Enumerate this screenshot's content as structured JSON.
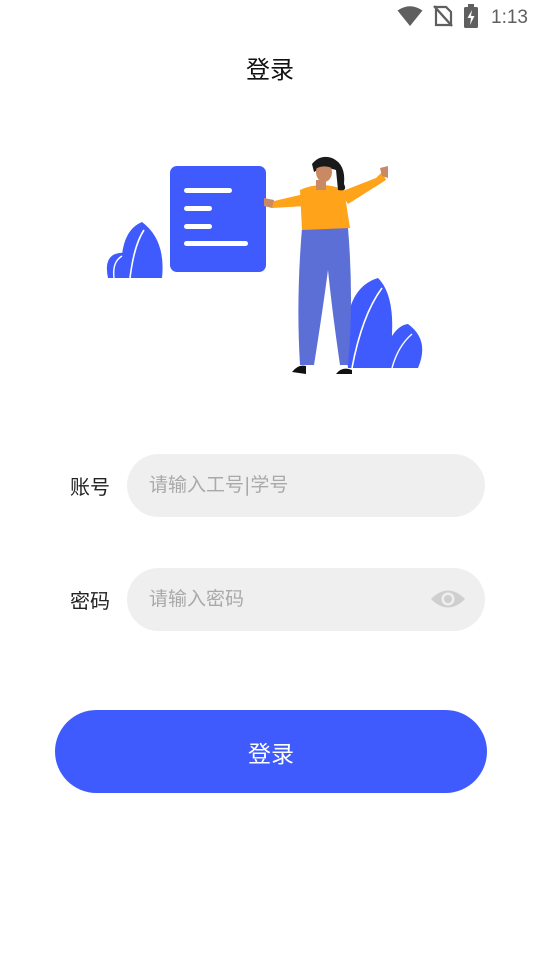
{
  "status_bar": {
    "time": "1:13",
    "icons": [
      "wifi-icon",
      "no-sim-icon",
      "battery-charging-icon"
    ]
  },
  "header": {
    "title": "登录"
  },
  "illustration": {
    "description_icon": "person-with-document-illustration",
    "colors": {
      "primary": "#3f5bfe",
      "shirt": "#ffa31a",
      "pants": "#5b6fd6"
    }
  },
  "form": {
    "account": {
      "label": "账号",
      "value": "",
      "placeholder": "请输入工号|学号"
    },
    "password": {
      "label": "密码",
      "value": "",
      "placeholder": "请输入密码",
      "toggle_icon": "eye-icon"
    },
    "submit_label": "登录"
  },
  "colors": {
    "accent": "#3f5bfe",
    "field_background": "#efefef",
    "placeholder": "#a9a9a9"
  }
}
